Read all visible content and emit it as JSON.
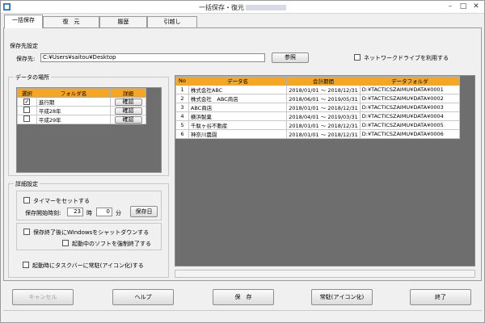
{
  "window": {
    "title": "一括保存・復元"
  },
  "tabs": [
    "一括保存",
    "復　元",
    "履歴",
    "引越し"
  ],
  "save_dest": {
    "group_label": "保存先設定",
    "label": "保存先:",
    "path": "C:¥Users¥saitou¥Desktop",
    "browse_button": "参照",
    "network_label": "ネットワークドライブを利用する"
  },
  "data_location": {
    "group_label": "データの場所",
    "columns": [
      "選択",
      "フォルダ名",
      "詳細"
    ],
    "rows": [
      {
        "checked": "✓",
        "folder": "進行期",
        "detail": "確認"
      },
      {
        "checked": "",
        "folder": "平成28年",
        "detail": "確認"
      },
      {
        "checked": "",
        "folder": "平成29年",
        "detail": "確認"
      }
    ]
  },
  "details": {
    "group_label": "詳細設定",
    "timer_label": "タイマーをセットする",
    "start_time_label": "保存開始時刻:",
    "hour_value": "23",
    "hour_unit": "時",
    "minute_value": "0",
    "minute_unit": "分",
    "save_day_button": "保存日",
    "shutdown_label": "保存終了後にWindowsをシャットダウンする",
    "force_quit_label": "起動中のソフトを強制終了する",
    "tray_label": "起動時にタスクバーに常駐(アイコン化)する"
  },
  "data_table": {
    "columns": [
      "No",
      "データ名",
      "会計期間",
      "データフォルダ"
    ],
    "rows": [
      {
        "no": "1",
        "name": "株式会社ABC",
        "period": "2018/01/01 ～ 2018/12/31",
        "folder": "D:¥TACTICSZAIMU¥DATA¥0001"
      },
      {
        "no": "2",
        "name": "株式会社　ABC商店",
        "period": "2018/06/01 ～ 2019/05/31",
        "folder": "D:¥TACTICSZAIMU¥DATA¥0002"
      },
      {
        "no": "3",
        "name": "ABC商店",
        "period": "2018/01/01 ～ 2018/12/31",
        "folder": "D:¥TACTICSZAIMU¥DATA¥0003"
      },
      {
        "no": "4",
        "name": "横浜製菓",
        "period": "2018/04/01 ～ 2019/03/31",
        "folder": "D:¥TACTICSZAIMU¥DATA¥0004"
      },
      {
        "no": "5",
        "name": "千駄ヶ谷不動産",
        "period": "2018/01/01 ～ 2018/12/31",
        "folder": "D:¥TACTICSZAIMU¥DATA¥0005"
      },
      {
        "no": "6",
        "name": "神奈川農園",
        "period": "2018/01/01 ～ 2018/12/31",
        "folder": "D:¥TACTICSZAIMU¥DATA¥0006"
      }
    ]
  },
  "footer": {
    "cancel": "キャンセル",
    "help": "ヘルプ",
    "save": "保　存",
    "resident": "常駐(アイコン化)",
    "exit": "終了"
  },
  "colors": {
    "header_orange": "#f5a623",
    "grid_gray": "#6e6e6e"
  }
}
